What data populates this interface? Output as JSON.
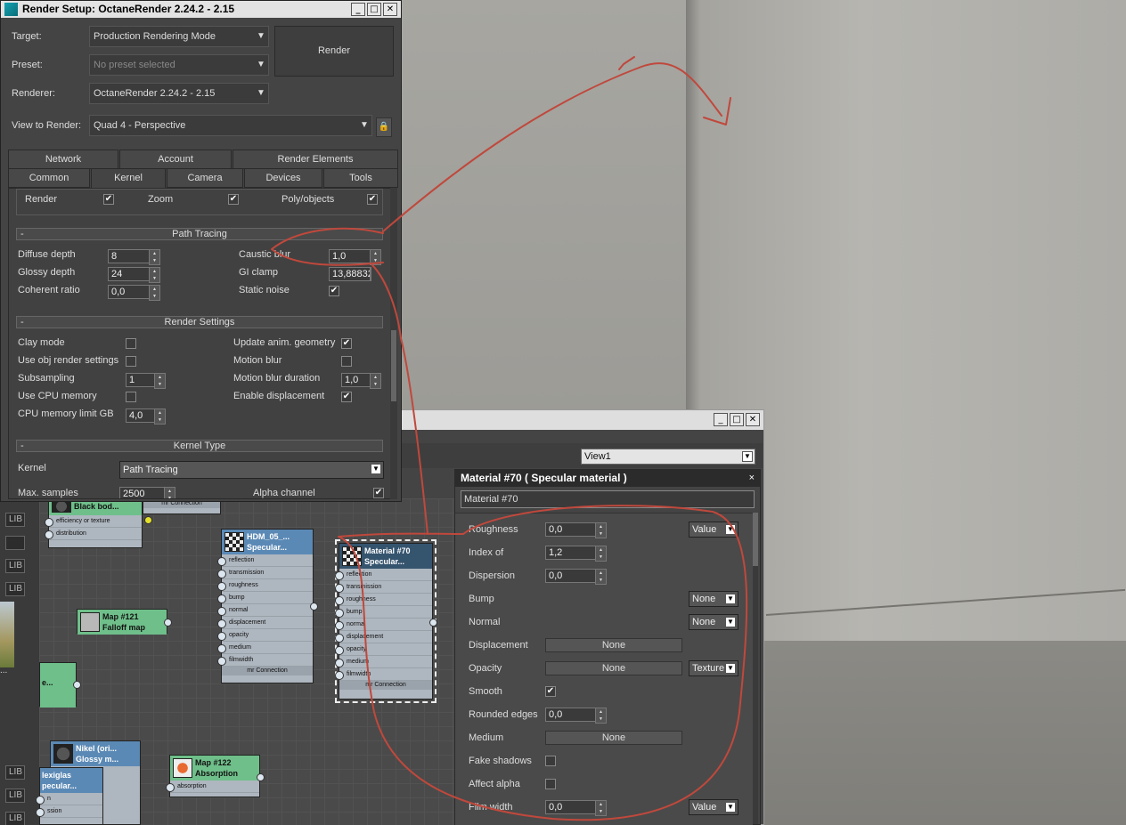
{
  "render_setup": {
    "title": "Render Setup: OctaneRender 2.24.2 - 2.15",
    "target_label": "Target:",
    "target_value": "Production Rendering Mode",
    "preset_label": "Preset:",
    "preset_value": "No preset selected",
    "renderer_label": "Renderer:",
    "renderer_value": "OctaneRender 2.24.2 - 2.15",
    "view_label": "View to Render:",
    "view_value": "Quad 4 - Perspective",
    "render_button": "Render",
    "tabs_row1": [
      "Network",
      "Account",
      "Render Elements"
    ],
    "tabs_row2": [
      "Common",
      "Kernel",
      "Camera",
      "Devices",
      "Tools"
    ],
    "active_tab": "Kernel",
    "top_row": {
      "render": "Render",
      "zoom": "Zoom",
      "poly": "Poly/objects"
    },
    "path_tracing": {
      "header": "Path Tracing",
      "diffuse_depth_label": "Diffuse depth",
      "diffuse_depth": "8",
      "glossy_depth_label": "Glossy depth",
      "glossy_depth": "24",
      "coherent_ratio_label": "Coherent ratio",
      "coherent_ratio": "0,0",
      "caustic_blur_label": "Caustic blur",
      "caustic_blur": "1,0",
      "gi_clamp_label": "GI clamp",
      "gi_clamp": "13,88832",
      "static_noise_label": "Static noise"
    },
    "render_settings": {
      "header": "Render Settings",
      "clay_mode": "Clay mode",
      "use_obj": "Use obj render settings",
      "subsampling_label": "Subsampling",
      "subsampling": "1",
      "use_cpu": "Use CPU memory",
      "cpu_limit_label": "CPU memory limit GB",
      "cpu_limit": "4,0",
      "update_anim": "Update anim. geometry",
      "motion_blur": "Motion blur",
      "motion_blur_dur_label": "Motion blur duration",
      "motion_blur_dur": "1,0",
      "enable_disp": "Enable displacement"
    },
    "kernel_type": {
      "header": "Kernel Type",
      "kernel_label": "Kernel",
      "kernel_value": "Path Tracing",
      "max_samples_label": "Max. samples",
      "max_samples": "2500",
      "alpha_channel": "Alpha channel"
    },
    "check_mark": "✔",
    "minus": "-"
  },
  "node_editor": {
    "view_value": "View1",
    "lib_label": "LIB",
    "strip_label": "...",
    "nodes": {
      "black_body": {
        "title1": "Black bod...",
        "rows": [
          "efficiency or texture",
          "distribution"
        ],
        "foot": "mr Connection"
      },
      "hdm": {
        "title1": "HDM_05_...",
        "title2": "Specular...",
        "rows": [
          "reflection",
          "transmission",
          "roughness",
          "bump",
          "normal",
          "displacement",
          "opacity",
          "medium",
          "filmwidth"
        ],
        "foot": "mr Connection"
      },
      "mat70": {
        "title1": "Material #70",
        "title2": "Specular...",
        "rows": [
          "reflection",
          "transmission",
          "roughness",
          "bump",
          "normal",
          "displacement",
          "opacity",
          "medium",
          "filmwidth"
        ],
        "foot": "mr Connection"
      },
      "map121": {
        "title1": "Map #121",
        "title2": "Falloff map"
      },
      "map122": {
        "title1": "Map #122",
        "title2": "Absorption",
        "rows": [
          "absorption"
        ]
      },
      "nikel": {
        "title1": "Nikel (ori...",
        "title2": "Glossy m..."
      },
      "plexiglas": {
        "title1": "lexiglas",
        "title2": "pecular...",
        "rows": [
          "n",
          "ssion"
        ]
      },
      "partial": {
        "title1": "e..."
      }
    }
  },
  "material_panel": {
    "title": "Material #70  ( Specular material )",
    "close": "×",
    "name": "Material #70",
    "rows": {
      "roughness_label": "Roughness",
      "roughness": "0,0",
      "roughness_mode": "Value",
      "ior_label": "Index of",
      "ior": "1,2",
      "dispersion_label": "Dispersion",
      "dispersion": "0,0",
      "bump_label": "Bump",
      "bump_mode": "None",
      "normal_label": "Normal",
      "normal_mode": "None",
      "displacement_label": "Displacement",
      "displacement_value": "None",
      "opacity_label": "Opacity",
      "opacity_value": "None",
      "opacity_mode": "Texture",
      "smooth_label": "Smooth",
      "rounded_label": "Rounded edges",
      "rounded": "0,0",
      "medium_label": "Medium",
      "medium_value": "None",
      "fake_shadows_label": "Fake shadows",
      "affect_alpha_label": "Affect alpha",
      "film_width_label": "Film width",
      "film_width": "0,0",
      "film_width_mode": "Value"
    }
  },
  "window_buttons": {
    "min": "_",
    "max": "□",
    "close": "✕"
  },
  "arrows": {
    "down": "▼"
  },
  "lock_icon": "🔒",
  "colors": {
    "annotation": "#c0483c",
    "teal_logo": "#14a3b4"
  }
}
